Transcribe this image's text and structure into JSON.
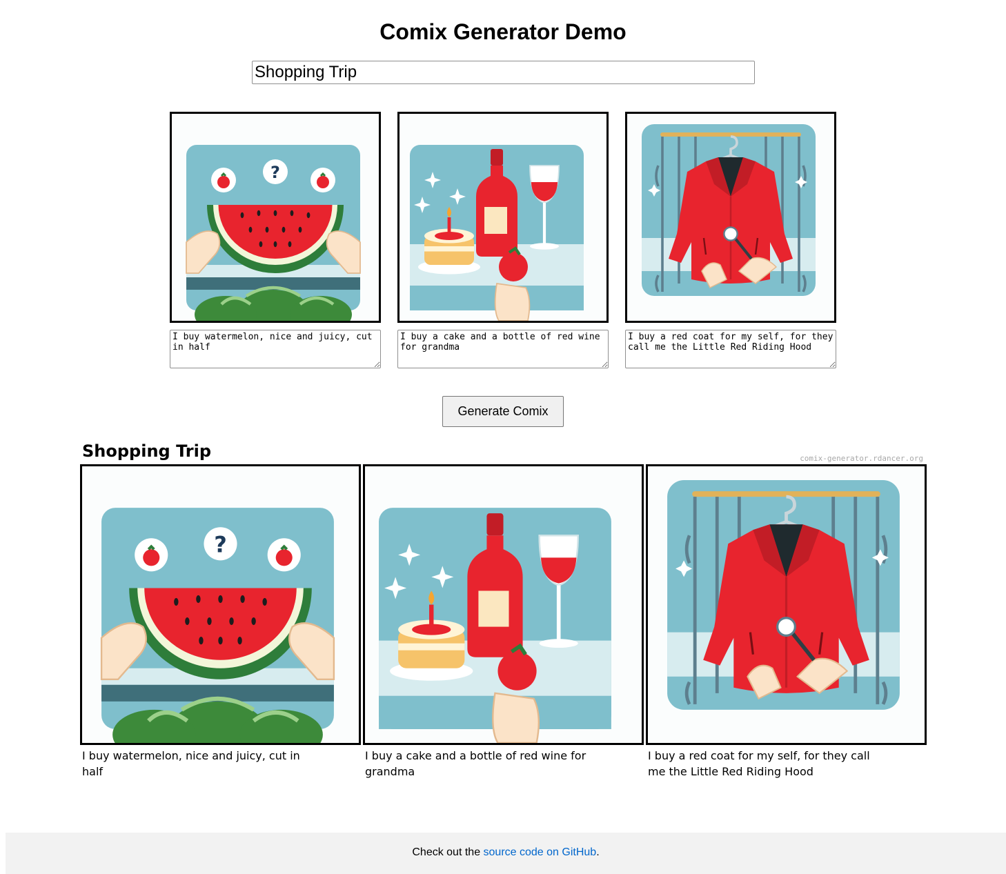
{
  "page": {
    "title": "Comix Generator Demo"
  },
  "editor": {
    "title_value": "Shopping Trip",
    "panels": [
      {
        "image_icon": "watermelon-illustration",
        "caption": "I buy watermelon, nice and juicy, cut in half"
      },
      {
        "image_icon": "cake-and-wine-illustration",
        "caption": "I buy a cake and a bottle of red wine for grandma"
      },
      {
        "image_icon": "red-coat-illustration",
        "caption": "I buy a red coat for my self, for they call me the Little Red Riding Hood"
      }
    ],
    "generate_label": "Generate Comix"
  },
  "output": {
    "title": "Shopping Trip",
    "watermark": "comix-generator.rdancer.org",
    "captions": [
      "I buy watermelon, nice and juicy, cut in half",
      "I buy a cake and a bottle of red wine for grandma",
      "I buy a red coat for my self, for they call me the Little Red Riding Hood"
    ]
  },
  "footer": {
    "prefix": "Check out the ",
    "link_text": "source code on GitHub",
    "suffix": "."
  },
  "colors": {
    "panel_bg": "#7fbfcc",
    "accent_red": "#e8242e",
    "link": "#0066cc",
    "footer_bg": "#f2f2f2"
  }
}
